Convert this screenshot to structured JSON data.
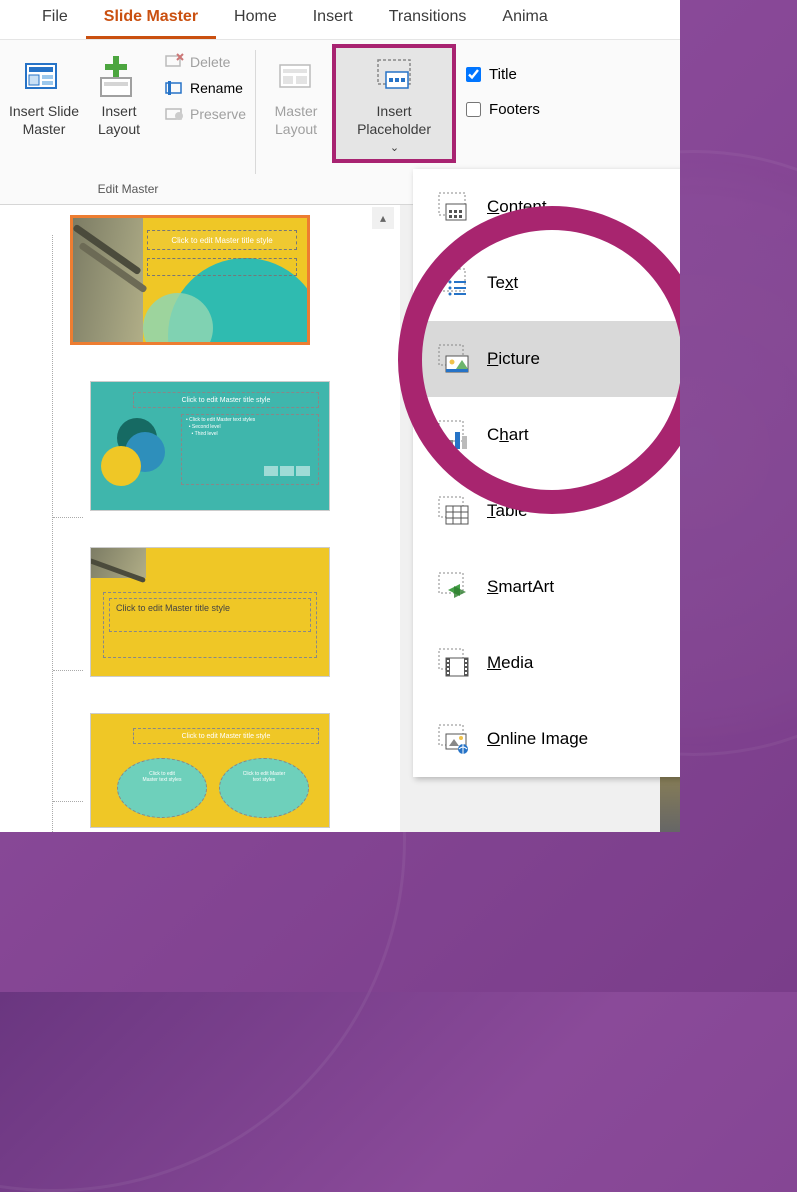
{
  "tabs": {
    "file": "File",
    "slideMaster": "Slide Master",
    "home": "Home",
    "insert": "Insert",
    "transitions": "Transitions",
    "animations": "Anima"
  },
  "ribbon": {
    "editMaster": {
      "insertSlideMaster_l1": "Insert Slide",
      "insertSlideMaster_l2": "Master",
      "insertLayout_l1": "Insert",
      "insertLayout_l2": "Layout",
      "delete": "Delete",
      "rename": "Rename",
      "preserve": "Preserve",
      "groupLabel": "Edit Master"
    },
    "masterLayout": {
      "masterLayout_l1": "Master",
      "masterLayout_l2": "Layout",
      "insertPlaceholder_l1": "Insert",
      "insertPlaceholder_l2": "Placeholder",
      "title": "Title",
      "footers": "Footers"
    }
  },
  "dropdown": {
    "content_u": "C",
    "content_r": "ontent",
    "text_pre": "Te",
    "text_u": "x",
    "text_post": "t",
    "picture_u": "P",
    "picture_r": "icture",
    "chart_pre": "C",
    "chart_u": "h",
    "chart_post": "art",
    "table_u": "T",
    "table_r": "able",
    "smartart_u": "S",
    "smartart_r": "martArt",
    "media_u": "M",
    "media_r": "edia",
    "online_u": "O",
    "online_r": "nline Image"
  },
  "thumbs": {
    "masterTitle": "Click to edit Master title style",
    "layoutTitle1": "Click to edit Master title style",
    "layoutTitle2": "Click to edit Master title style",
    "layoutTitle3": "Click to edit Master title style"
  },
  "colors": {
    "accent": "#CA5010",
    "highlight": "#a8256f"
  }
}
